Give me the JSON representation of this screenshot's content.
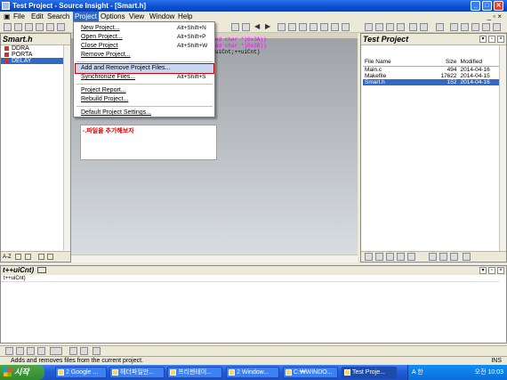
{
  "window": {
    "title": "Test Project - Source Insight - [Smart.h]"
  },
  "menubar": {
    "items": [
      "File",
      "Edit",
      "Search",
      "Project",
      "Options",
      "View",
      "Window",
      "Help"
    ]
  },
  "project_menu": {
    "items": [
      {
        "label": "New Project...",
        "shortcut": "Alt+Shift+N"
      },
      {
        "label": "Open Project...",
        "shortcut": "Alt+Shift+P"
      },
      {
        "label": "Close Project",
        "shortcut": "Alt+Shift+W"
      },
      {
        "label": "Remove Project...",
        "shortcut": ""
      },
      {
        "label": "Add and Remove Project Files...",
        "shortcut": ""
      },
      {
        "label": "Synchronize Files...",
        "shortcut": "Alt+Shift+S"
      },
      {
        "label": "Project Report...",
        "shortcut": ""
      },
      {
        "label": "Rebuild Project...",
        "shortcut": ""
      },
      {
        "label": "Default Project Settings...",
        "shortcut": ""
      }
    ]
  },
  "symbol_panel": {
    "title": "Smart.h",
    "symbols": [
      "DDRA",
      "PORTA",
      "DELAY"
    ],
    "tools_label": "A-Z"
  },
  "editor": {
    "code_lines": [
      "ed char *)0x3A))",
      "ed char *)0x3B))",
      "uiCnt;++uiCnt)"
    ],
    "annotation": "-.파일을 추가해보자"
  },
  "project_panel": {
    "title": "Test Project",
    "columns": [
      "File Name",
      "Size",
      "Modified"
    ],
    "files": [
      {
        "name": "Main.c",
        "size": "494",
        "modified": "2014-04-16"
      },
      {
        "name": "Makefile",
        "size": "17622",
        "modified": "2014-04-15"
      },
      {
        "name": "Smart.h",
        "size": "152",
        "modified": "2014-04-16"
      }
    ]
  },
  "context_panel": {
    "title": "t++uiCnt)",
    "line": "t++uiCnt)"
  },
  "statusbar": {
    "message": "Adds and removes files from the current project.",
    "mode": "INS"
  },
  "taskbar": {
    "start_label": "시작",
    "tasks": [
      "2 Google ...",
      "헤더파일만...",
      "프리젠테이...",
      "2 Window...",
      "C:₩WINDO...",
      "Test Proje..."
    ],
    "tray_lang": "A 한",
    "clock": "오전 10:03"
  }
}
